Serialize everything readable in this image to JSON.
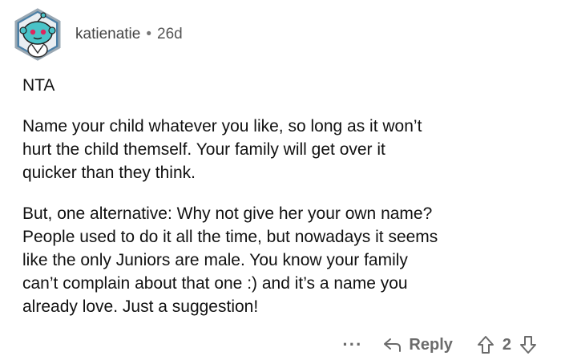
{
  "comment": {
    "username": "katienatie",
    "separator": "•",
    "age": "26d",
    "paragraphs": [
      "NTA",
      "Name your child whatever you like, so long as it won’t\nhurt the child themself. Your family will get over it\nquicker than they think.",
      "But, one alternative: Why not give her your own name?\nPeople used to do it all the time, but nowadays it seems\nlike the only Juniors are male. You know your family\ncan’t complain about that one :) and it’s a name you\nalready love. Just a suggestion!"
    ]
  },
  "actions": {
    "more": "···",
    "reply_label": "Reply",
    "vote_count": "2"
  },
  "icons": {
    "avatar": "snoo-avatar-icon",
    "reply": "reply-arrow-icon",
    "upvote": "upvote-arrow-icon",
    "downvote": "downvote-arrow-icon"
  },
  "colors": {
    "avatar_bg": "#4a7fa6",
    "avatar_face": "#49c3c8",
    "action_gray": "#6b6b6b"
  }
}
